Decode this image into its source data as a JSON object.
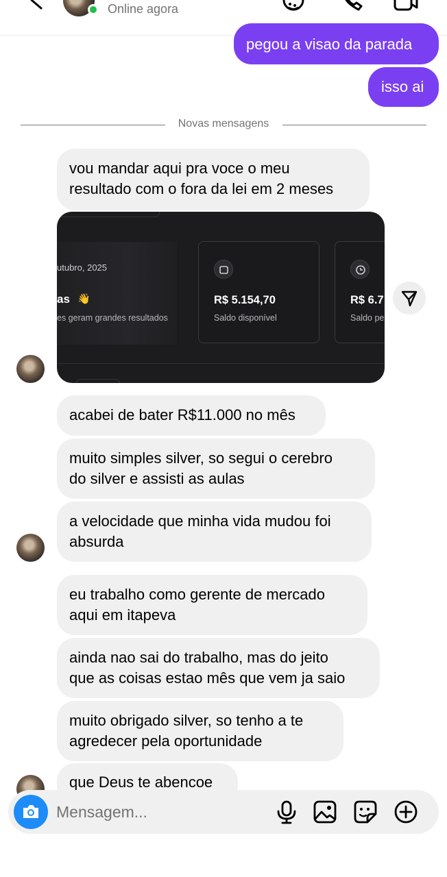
{
  "header": {
    "status": "Online agora"
  },
  "messages": {
    "out1": "pegou a visao da parada",
    "out2": "isso ai",
    "divider": "Novas mensagens",
    "in1_l1": "vou mandar aqui pra voce o meu",
    "in1_l2": "resultado com o fora da lei em 2 meses",
    "in2": "acabei de bater R$11.000 no mês",
    "in3_l1": "muito simples silver, so segui o cerebro",
    "in3_l2": "do silver e assisti as aulas",
    "in4_l1": "a velocidade que minha vida mudou foi",
    "in4_l2": "absurda",
    "in5_l1": "eu trabalho como gerente de mercado",
    "in5_l2": "aqui em itapeva",
    "in6_l1": "ainda nao sai do trabalho, mas do jeito",
    "in6_l2": "que as coisas estao mês que vem ja saio",
    "in7_l1": "muito obrigado silver, so tenho a te",
    "in7_l2": "agredecer pela oportunidade",
    "in8": "que Deus te abencoe"
  },
  "screenshot": {
    "date": "utubro, 2025",
    "heading": "as",
    "subtitle": "es geram grandes resultados",
    "card1_value": "R$ 5.154,70",
    "card1_label": "Saldo disponível",
    "card2_value": "R$ 6.7",
    "card2_label": "Saldo pe"
  },
  "composer": {
    "placeholder": "Mensagem..."
  },
  "icons": {
    "back": "chevron-left-icon",
    "sticker": "sticker-icon",
    "call": "phone-icon",
    "video": "video-camera-icon",
    "share": "send-icon",
    "camera": "camera-icon",
    "mic": "microphone-icon",
    "gallery": "image-icon",
    "emoji": "sticker-icon",
    "plus": "plus-circle-icon"
  },
  "colors": {
    "outgoing_bubble": "#7b3ff2",
    "incoming_bubble": "#f0f0f1",
    "online": "#1fbf4d",
    "camera_button": "#1d8cf8"
  }
}
